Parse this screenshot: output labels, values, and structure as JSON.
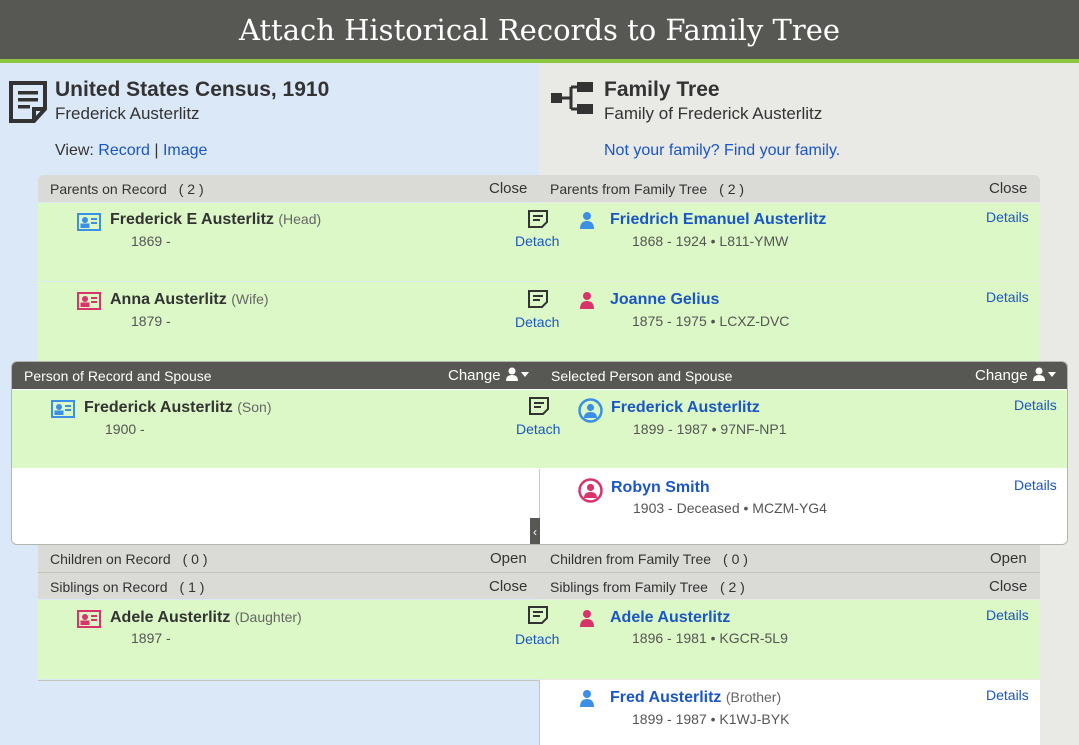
{
  "header": {
    "title": "Attach Historical Records to Family Tree"
  },
  "colors": {
    "accent": "#8cc63f",
    "link": "#1a56c4",
    "match_bg": "#dcf8c6",
    "male": "#3b8fe6",
    "female": "#d9336b"
  },
  "source": {
    "title": "United States Census, 1910",
    "subtitle": "Frederick Austerlitz",
    "view_label": "View:",
    "view_record": "Record",
    "view_separator": "|",
    "view_image": "Image"
  },
  "tree": {
    "title": "Family Tree",
    "subtitle": "Family of Frederick Austerlitz",
    "not_family_link": "Not your family? Find your family."
  },
  "parents": {
    "left_label": "Parents on Record",
    "left_count": "( 2 )",
    "left_toggle": "Close",
    "right_label": "Parents from Family Tree",
    "right_count": "( 2 )",
    "right_toggle": "Close",
    "rows": [
      {
        "rec_name": "Frederick E Austerlitz",
        "rec_role": "(Head)",
        "rec_dates": "1869 -",
        "detach": "Detach",
        "tree_name": "Friedrich Emanuel Austerlitz",
        "tree_info": "1868 - 1924 • L811-YMW",
        "details": "Details",
        "gender": "male"
      },
      {
        "rec_name": "Anna Austerlitz",
        "rec_role": "(Wife)",
        "rec_dates": "1879 -",
        "detach": "Detach",
        "tree_name": "Joanne Gelius",
        "tree_info": "1875 - 1975 • LCXZ-DVC",
        "details": "Details",
        "gender": "female"
      }
    ]
  },
  "principal": {
    "left_label": "Person of Record and Spouse",
    "left_change": "Change",
    "right_label": "Selected Person and Spouse",
    "right_change": "Change",
    "row1": {
      "rec_name": "Frederick Austerlitz",
      "rec_role": "(Son)",
      "rec_dates": "1900 -",
      "detach": "Detach",
      "tree_name": "Frederick Austerlitz",
      "tree_info": "1899 - 1987 • 97NF-NP1",
      "details": "Details"
    },
    "row2": {
      "tree_name": "Robyn Smith",
      "tree_info": "1903 - Deceased • MCZM-YG4",
      "details": "Details"
    },
    "collapse_glyph": "‹"
  },
  "children": {
    "left_label": "Children on Record",
    "left_count": "( 0 )",
    "left_toggle": "Open",
    "right_label": "Children from Family Tree",
    "right_count": "( 0 )",
    "right_toggle": "Open"
  },
  "siblings": {
    "left_label": "Siblings on Record",
    "left_count": "( 1 )",
    "left_toggle": "Close",
    "right_label": "Siblings from Family Tree",
    "right_count": "( 2 )",
    "right_toggle": "Close",
    "row1": {
      "rec_name": "Adele Austerlitz",
      "rec_role": "(Daughter)",
      "rec_dates": "1897 -",
      "detach": "Detach",
      "tree_name": "Adele Austerlitz",
      "tree_info": "1896 - 1981 • KGCR-5L9",
      "details": "Details"
    },
    "row2": {
      "tree_name": "Fred Austerlitz",
      "tree_role": "(Brother)",
      "tree_info": "1899 - 1987 • K1WJ-BYK",
      "details": "Details"
    }
  }
}
